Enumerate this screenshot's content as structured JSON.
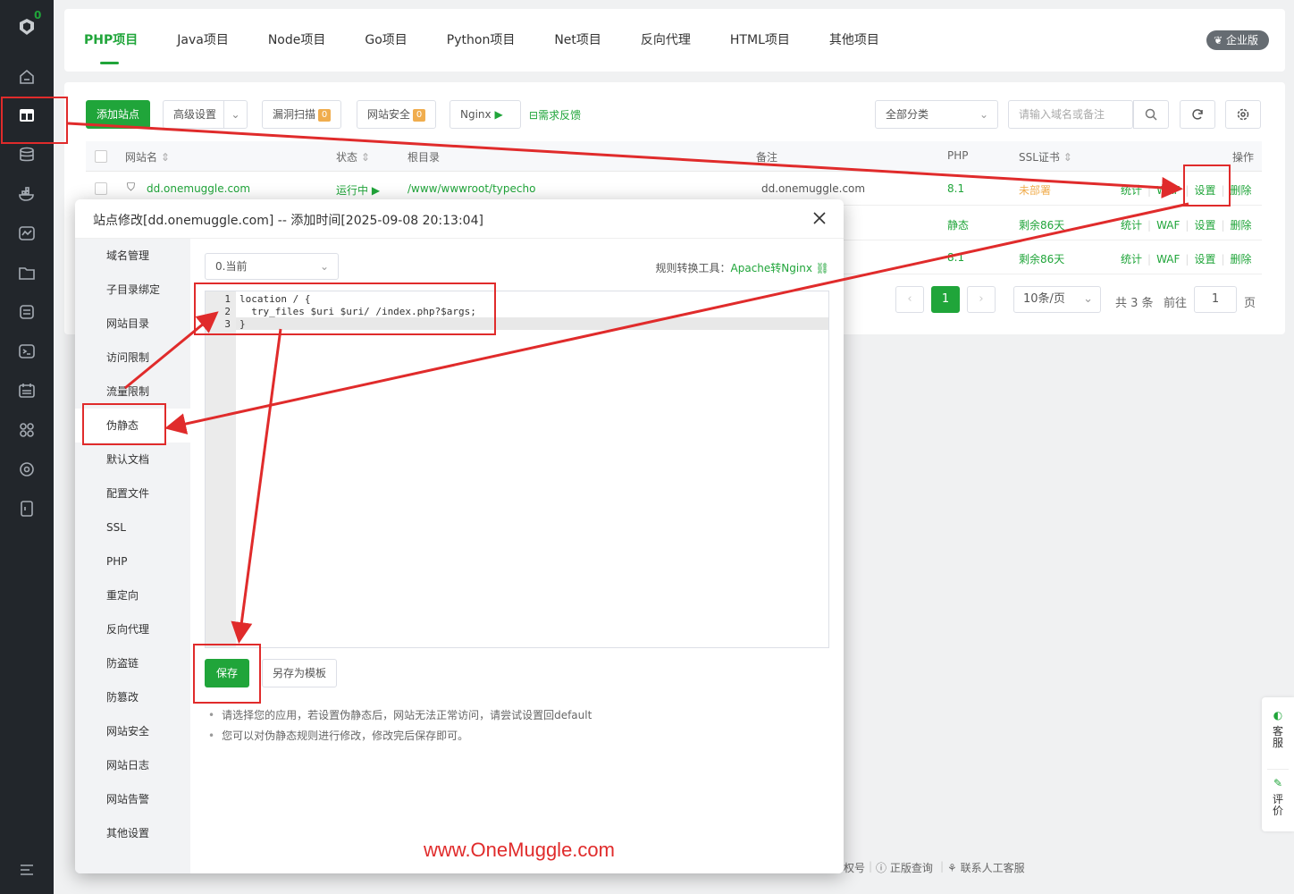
{
  "sidebar": {
    "badge": "0"
  },
  "topbar": {
    "tabs": [
      {
        "label": "PHP项目"
      },
      {
        "label": "Java项目"
      },
      {
        "label": "Node项目"
      },
      {
        "label": "Go项目"
      },
      {
        "label": "Python项目"
      },
      {
        "label": "Net项目"
      },
      {
        "label": "反向代理"
      },
      {
        "label": "HTML项目"
      },
      {
        "label": "其他项目"
      }
    ],
    "enterprise_label": "企业版"
  },
  "toolbar": {
    "add_site": "添加站点",
    "advanced": "高级设置",
    "vuln_scan": "漏洞扫描",
    "vuln_count": "0",
    "site_security": "网站安全",
    "security_count": "0",
    "nginx": "Nginx",
    "feedback": "需求反馈",
    "category": "全部分类",
    "search_placeholder": "请输入域名或备注"
  },
  "table": {
    "headers": {
      "name": "网站名",
      "status": "状态",
      "root": "根目录",
      "remark": "备注",
      "php": "PHP",
      "ssl": "SSL证书",
      "ops": "操作"
    },
    "rows": [
      {
        "name": "dd.onemuggle.com",
        "status": "运行中",
        "root": "/www/wwwroot/typecho",
        "remark": "dd.onemuggle.com",
        "php": "8.1",
        "ssl": "未部署"
      },
      {
        "php": "静态",
        "ssl": "剩余86天"
      },
      {
        "php": "8.1",
        "ssl": "剩余86天"
      }
    ],
    "actions": {
      "stats": "统计",
      "waf": "WAF",
      "settings": "设置",
      "delete": "删除"
    }
  },
  "pager": {
    "current": "1",
    "per_page": "10条/页",
    "total": "共 3 条",
    "goto": "前往",
    "page_input": "1",
    "page_unit": "页"
  },
  "footer": {
    "item1": "权号",
    "item2": "正版查询",
    "item3": "联系人工客服"
  },
  "float_panel": {
    "service": "客服",
    "review": "评价"
  },
  "modal": {
    "title": "站点修改[dd.onemuggle.com] -- 添加时间[2025-09-08 20:13:04]",
    "side_items": [
      "域名管理",
      "子目录绑定",
      "网站目录",
      "访问限制",
      "流量限制",
      "伪静态",
      "默认文档",
      "配置文件",
      "SSL",
      "PHP",
      "重定向",
      "反向代理",
      "防盗链",
      "防篡改",
      "网站安全",
      "网站日志",
      "网站告警",
      "其他设置"
    ],
    "version_select": "0.当前",
    "conv_label": "规则转换工具：",
    "conv_link": "Apache转Nginx",
    "code_lines": [
      "location / {",
      "  try_files $uri $uri/ /index.php?$args;",
      "}"
    ],
    "save": "保存",
    "save_template": "另存为模板",
    "tips": [
      "请选择您的应用，若设置伪静态后，网站无法正常访问，请尝试设置回default",
      "您可以对伪静态规则进行修改，修改完后保存即可。"
    ]
  },
  "watermark": "www.OneMuggle.com"
}
